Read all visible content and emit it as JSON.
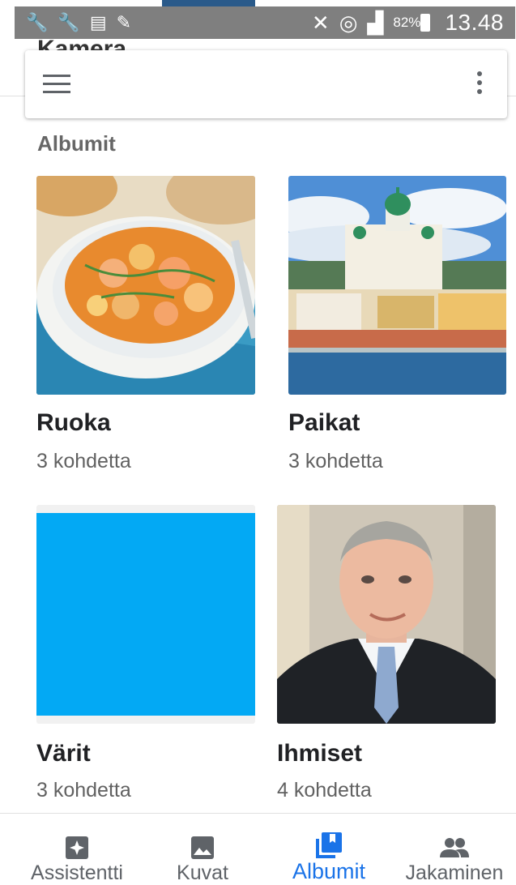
{
  "status_bar": {
    "battery": "82%",
    "time": "13.48"
  },
  "behind_title": "Kamera",
  "section_title": "Albumit",
  "albums": [
    {
      "name": "Ruoka",
      "count": "3 kohdetta"
    },
    {
      "name": "Paikat",
      "count": "3 kohdetta"
    },
    {
      "name": "Värit",
      "count": "3 kohdetta"
    },
    {
      "name": "Ihmiset",
      "count": "4 kohdetta"
    }
  ],
  "bottom_nav": [
    {
      "label": "Assistentti",
      "icon": "assistant-icon"
    },
    {
      "label": "Kuvat",
      "icon": "photo-icon"
    },
    {
      "label": "Albumit",
      "icon": "albums-icon",
      "active": true
    },
    {
      "label": "Jakaminen",
      "icon": "people-icon"
    }
  ],
  "colors": {
    "accent": "#1a73e8",
    "varit_swatch": "#03a9f4",
    "status_bar": "#7f7f7f"
  }
}
